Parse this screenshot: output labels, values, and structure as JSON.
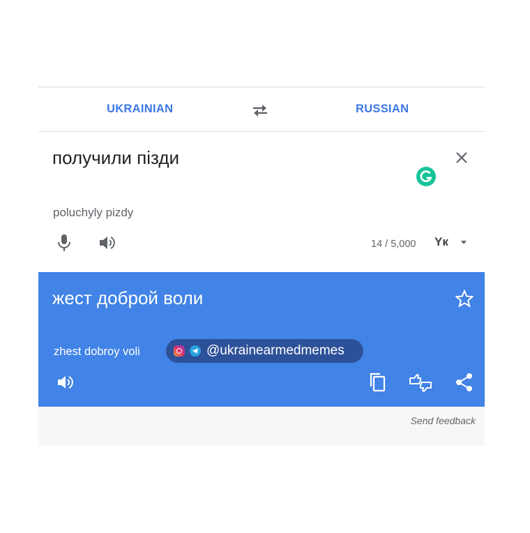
{
  "languages": {
    "source": "UKRAINIAN",
    "target": "RUSSIAN"
  },
  "source": {
    "text": "получили пізди",
    "transliteration": "poluchyly pizdy",
    "char_count": "14 / 5,000",
    "keyboard_label": "Yк"
  },
  "result": {
    "text": "жест доброй воли",
    "transliteration": "zhest dobroy voli"
  },
  "watermark": {
    "handle": "@ukrainearmedmemes"
  },
  "footer": {
    "feedback": "Send feedback"
  },
  "colors": {
    "accent": "#3b78e7",
    "result_bg": "#4183e6",
    "grammarly": "#15c39a"
  },
  "icons": [
    "swap-icon",
    "close-icon",
    "grammarly-icon",
    "microphone-icon",
    "speaker-icon",
    "keyboard-icon",
    "star-icon",
    "copy-icon",
    "edit-suggestion-icon",
    "share-icon",
    "instagram-icon",
    "telegram-icon"
  ]
}
